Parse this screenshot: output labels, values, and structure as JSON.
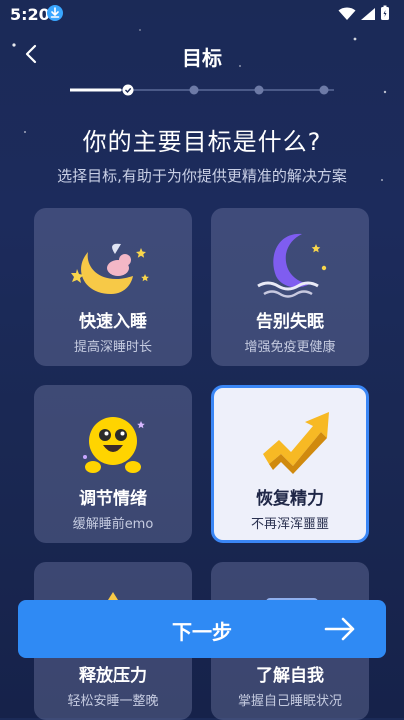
{
  "status_bar": {
    "time": "5:20"
  },
  "nav": {
    "title": "目标"
  },
  "progress": {
    "current_step": 1,
    "total_steps": 4
  },
  "heading": "你的主要目标是什么?",
  "subheading": "选择目标,有助于为你提供更精准的解决方案",
  "goals": [
    {
      "title": "快速入睡",
      "subtitle": "提高深睡时长",
      "icon": "moon-with-dreamer-icon",
      "selected": false
    },
    {
      "title": "告别失眠",
      "subtitle": "增强免疫更健康",
      "icon": "crescent-moon-waves-icon",
      "selected": false
    },
    {
      "title": "调节情绪",
      "subtitle": "缓解睡前emo",
      "icon": "happy-face-icon",
      "selected": false
    },
    {
      "title": "恢复精力",
      "subtitle": "不再浑浑噩噩",
      "icon": "up-arrow-icon",
      "selected": true
    },
    {
      "title": "释放压力",
      "subtitle": "轻松安睡一整晚",
      "icon": "star-icon",
      "selected": false
    },
    {
      "title": "了解自我",
      "subtitle": "掌握自己睡眠状况",
      "icon": "profile-card-icon",
      "selected": false
    }
  ],
  "next_button": {
    "label": "下一步"
  },
  "colors": {
    "accent": "#2f8af4",
    "selected_border": "#3a86f5",
    "background": "#1b2a57"
  }
}
